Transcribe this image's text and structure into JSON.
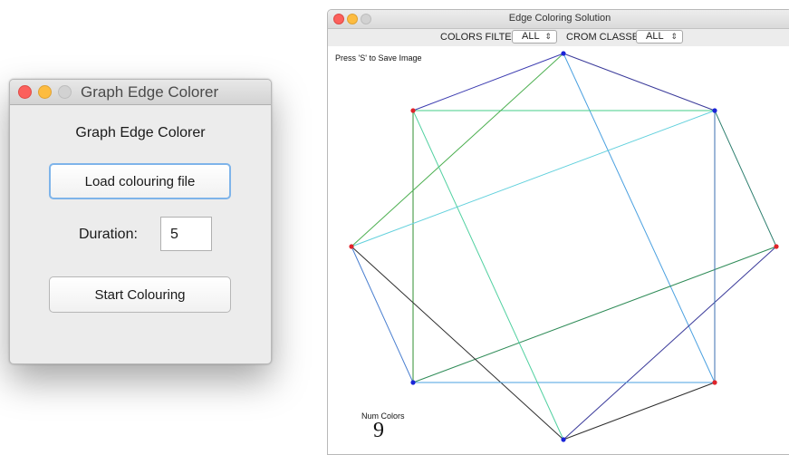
{
  "left_window": {
    "title": "Graph Edge Colorer",
    "heading": "Graph Edge Colorer",
    "load_button": "Load colouring file",
    "duration_label": "Duration:",
    "duration_value": "5",
    "start_button": "Start Colouring"
  },
  "right_window": {
    "title": "Edge Coloring Solution",
    "colors_filter_label": "COLORS FILTER",
    "colors_filter_value": "ALL",
    "crom_classes_label": "CROM CLASSES",
    "crom_classes_value": "ALL",
    "save_hint": "Press 'S' to Save Image",
    "num_colors_label": "Num Colors",
    "num_colors_value": "9"
  },
  "graph": {
    "node_count": 8,
    "node_colors": [
      "blue",
      "blue",
      "red",
      "red",
      "blue",
      "red",
      "red",
      "blue"
    ],
    "edge_colors": [
      "#3b3bb0",
      "#4aa0e0",
      "#44cc88",
      "#2f8f2f",
      "#2e7f6f",
      "#3a3a9a",
      "#60d0dc",
      "#2c2c2c",
      "#4caf50",
      "#2e8b57",
      "#4a7fd0",
      "#3a3a9a",
      "#2c2c2c",
      "#4aa0e0",
      "#50d0a0",
      "#3b6fb0"
    ],
    "colors": {
      "red": "#e0242a",
      "blue": "#1a24d8"
    }
  }
}
